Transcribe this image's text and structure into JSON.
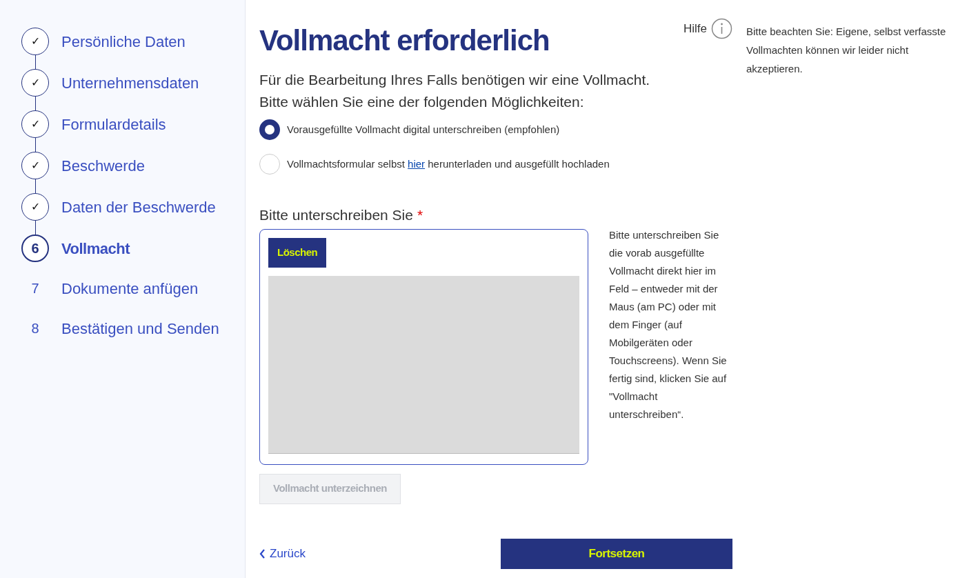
{
  "steps": [
    {
      "marker": "✓",
      "label": "Persönliche Daten",
      "completed": true,
      "current": false
    },
    {
      "marker": "✓",
      "label": "Unternehmensdaten",
      "completed": true,
      "current": false
    },
    {
      "marker": "✓",
      "label": "Formulardetails",
      "completed": true,
      "current": false
    },
    {
      "marker": "✓",
      "label": "Beschwerde",
      "completed": true,
      "current": false
    },
    {
      "marker": "✓",
      "label": "Daten der Beschwerde",
      "completed": true,
      "current": false
    },
    {
      "marker": "6",
      "label": "Vollmacht",
      "completed": false,
      "current": true
    },
    {
      "marker": "7",
      "label": "Dokumente anfügen",
      "completed": false,
      "current": false
    },
    {
      "marker": "8",
      "label": "Bestätigen und Senden",
      "completed": false,
      "current": false
    }
  ],
  "title": "Vollmacht erforderlich",
  "help": {
    "label": "Hilfe"
  },
  "intro": [
    "Für die Bearbeitung Ihres Falls benötigen wir eine Vollmacht.",
    "Bitte wählen Sie eine der folgenden Möglichkeiten:"
  ],
  "options": [
    {
      "text": "Vorausgefüllte Vollmacht digital unterschreiben (empfohlen)",
      "selected": true
    },
    {
      "text": "Vollmachtsformular selbst ",
      "link": "hier",
      "text_after": " herunterladen und ausgefüllt hochladen",
      "selected": false
    }
  ],
  "signature": {
    "label": "Bitte unterschreiben Sie",
    "required_mark": "*",
    "clear_button": "Löschen",
    "hint": "Bitte unterschreiben Sie die vorab ausgefüllte Vollmacht direkt hier im Feld – entweder mit der Maus (am PC) oder mit dem Finger (auf Mobilgeräten oder Touchscreens). Wenn Sie fertig sind, klicken Sie auf \"Vollmacht unterschreiben“.",
    "sign_button": {
      "label": "Vollmacht unterzeichnen",
      "disabled": true
    }
  },
  "back_link": "Zurück",
  "continue_button": "Fortsetzen",
  "note": "Bitte beachten Sie: Eigene, selbst verfasste Vollmachten können wir leider nicht akzeptieren."
}
